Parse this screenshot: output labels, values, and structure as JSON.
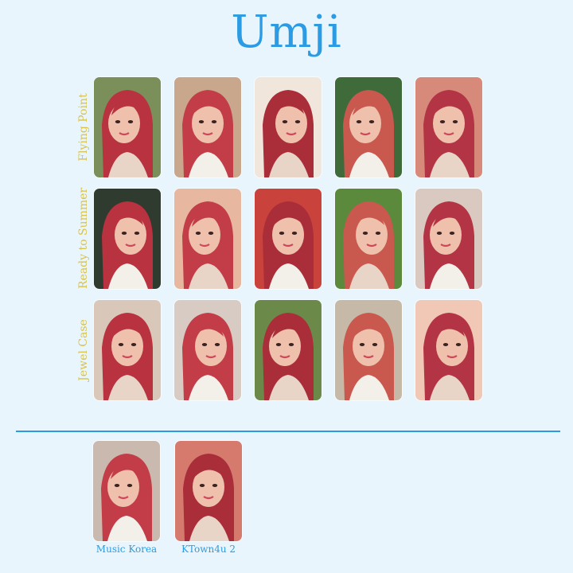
{
  "title": "Umji",
  "rows": [
    {
      "label": "Flying Point"
    },
    {
      "label": "Ready to Summer"
    },
    {
      "label": "Jewel Case"
    }
  ],
  "bonus": [
    {
      "label": "Music Korea"
    },
    {
      "label": "KTown4u 2"
    }
  ],
  "colors": {
    "background": "#e9f5fd",
    "title": "#2b9be3",
    "row_label": "#d8c24a",
    "divider": "#2b9be3",
    "hair": "#b8323f",
    "skin": "#efc1ad"
  }
}
